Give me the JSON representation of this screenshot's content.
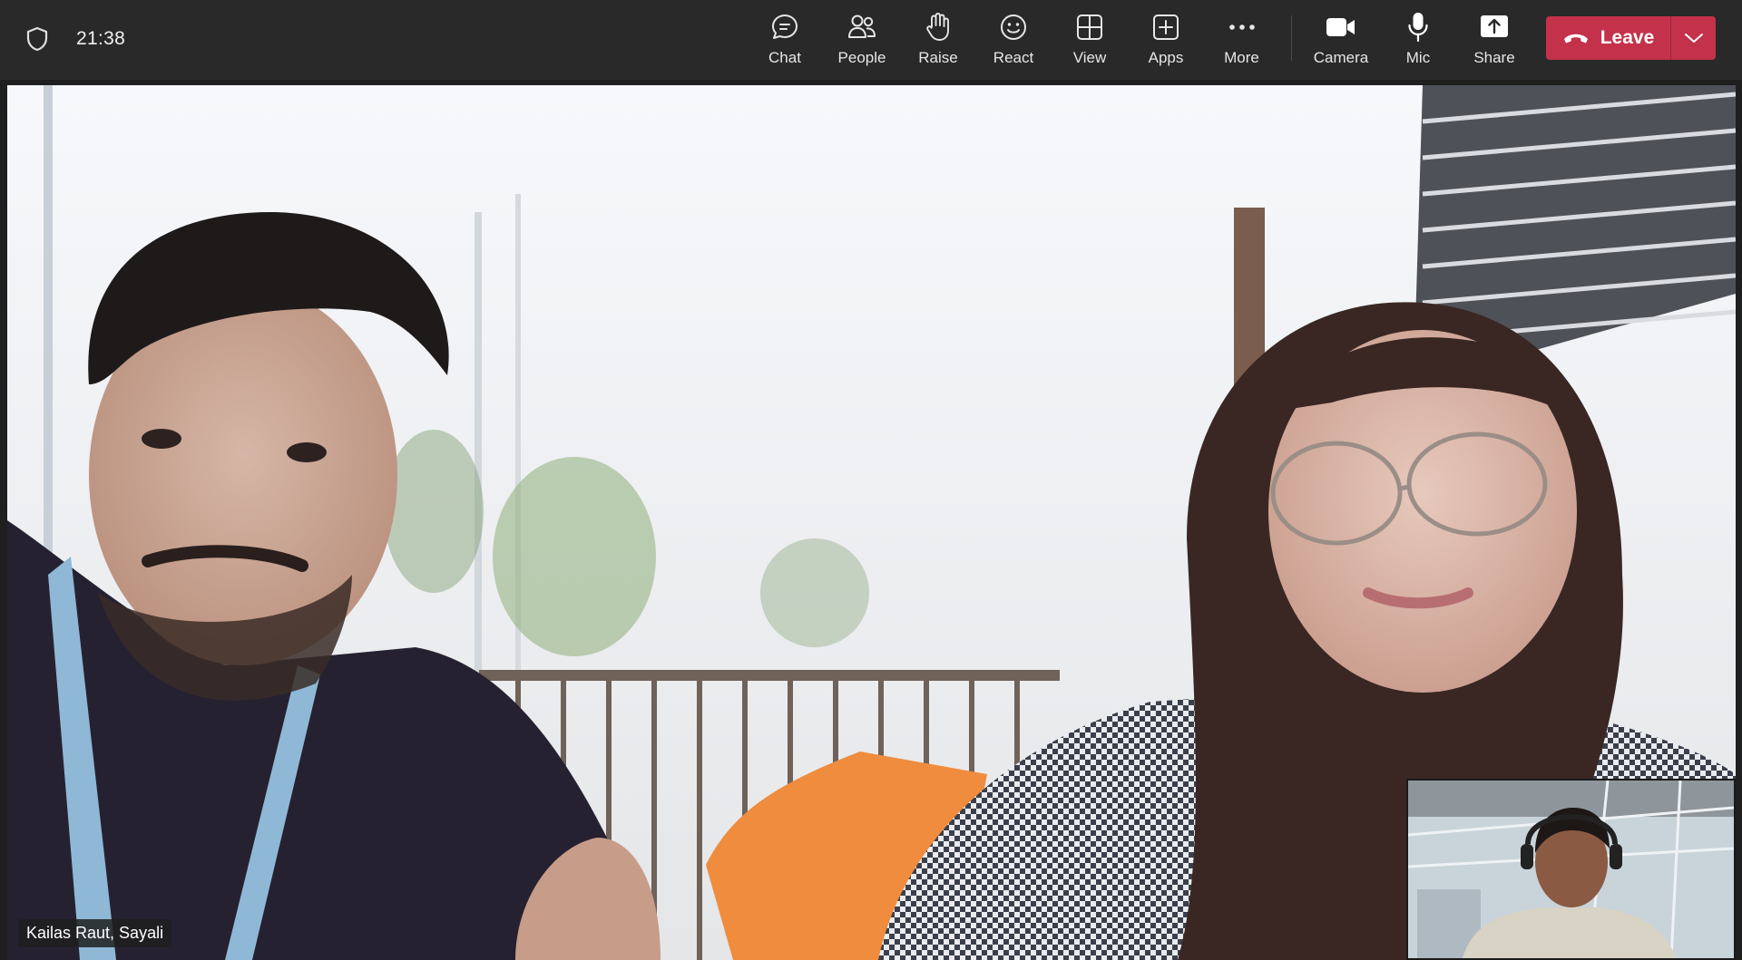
{
  "status": {
    "time": "21:38"
  },
  "toolbar": {
    "chat": "Chat",
    "people": "People",
    "raise": "Raise",
    "react": "React",
    "view": "View",
    "apps": "Apps",
    "more": "More",
    "camera": "Camera",
    "mic": "Mic",
    "share": "Share",
    "leave": "Leave"
  },
  "stage": {
    "participant_name": "Kailas Raut, Sayali"
  },
  "colors": {
    "topbar": "#292929",
    "leave_button": "#c4314b",
    "background": "#1f1f1f"
  }
}
